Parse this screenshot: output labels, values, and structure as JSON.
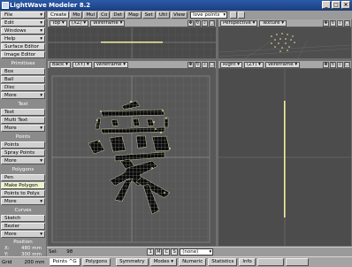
{
  "window": {
    "title": "LightWave Modeler 8.2",
    "buttons": [
      "_",
      "□",
      "×"
    ]
  },
  "left_menu": [
    "File",
    "Edit",
    "Windows",
    "Help",
    "Surface Editor",
    "Image Editor"
  ],
  "groups": [
    {
      "title": "Primitives",
      "items": [
        "Box",
        "Ball",
        "Disc"
      ],
      "more": "More"
    },
    {
      "title": "Text",
      "items": [
        "Text",
        "Multi Text"
      ],
      "more": "More"
    },
    {
      "title": "Points",
      "items": [
        "Points",
        "Spray Points"
      ],
      "more": "More"
    },
    {
      "title": "Polygons",
      "items": [
        "Pen",
        "Make Polygon",
        "Points to Polys"
      ],
      "active": "Make Polygon",
      "more": "More"
    },
    {
      "title": "Curves",
      "items": [
        "Sketch",
        "Bezier"
      ],
      "more": "More"
    }
  ],
  "position": {
    "title": "Position",
    "x_label": "X:",
    "x_value": "480 mm",
    "y_label": "Y:",
    "y_value": "300 mm",
    "z_label": "Z:",
    "z_value": ""
  },
  "grid": {
    "label": "Grid",
    "value": "200 mm"
  },
  "tabs": [
    "Create",
    "Mo",
    "Mul",
    "Co",
    "Det",
    "Map",
    "Set",
    "Util",
    "View"
  ],
  "active_tab": "Create",
  "tab_selector": "love points",
  "viewports": {
    "top": {
      "name": "Top",
      "axis": "(XZ)",
      "mode": "Wireframe"
    },
    "perspective": {
      "name": "Perspective",
      "mode": "Texture"
    },
    "back": {
      "name": "Back",
      "axis": "(XY)",
      "mode": "Wireframe"
    },
    "right": {
      "name": "Right",
      "axis": "(ZY)",
      "mode": "Wireframe"
    }
  },
  "status": {
    "sel_label": "Sel:",
    "sel_value": "98",
    "layer_buttons": [
      "1",
      "M",
      "C",
      "S"
    ],
    "none_label": "(none)"
  },
  "bottom": {
    "points": "Points",
    "points_shortcut": "^G",
    "polygons": "Polygons",
    "symmetry": "Symmetry",
    "modes": "Modes",
    "numeric": "Numeric",
    "statistics": "Statistics",
    "info": "Info"
  }
}
